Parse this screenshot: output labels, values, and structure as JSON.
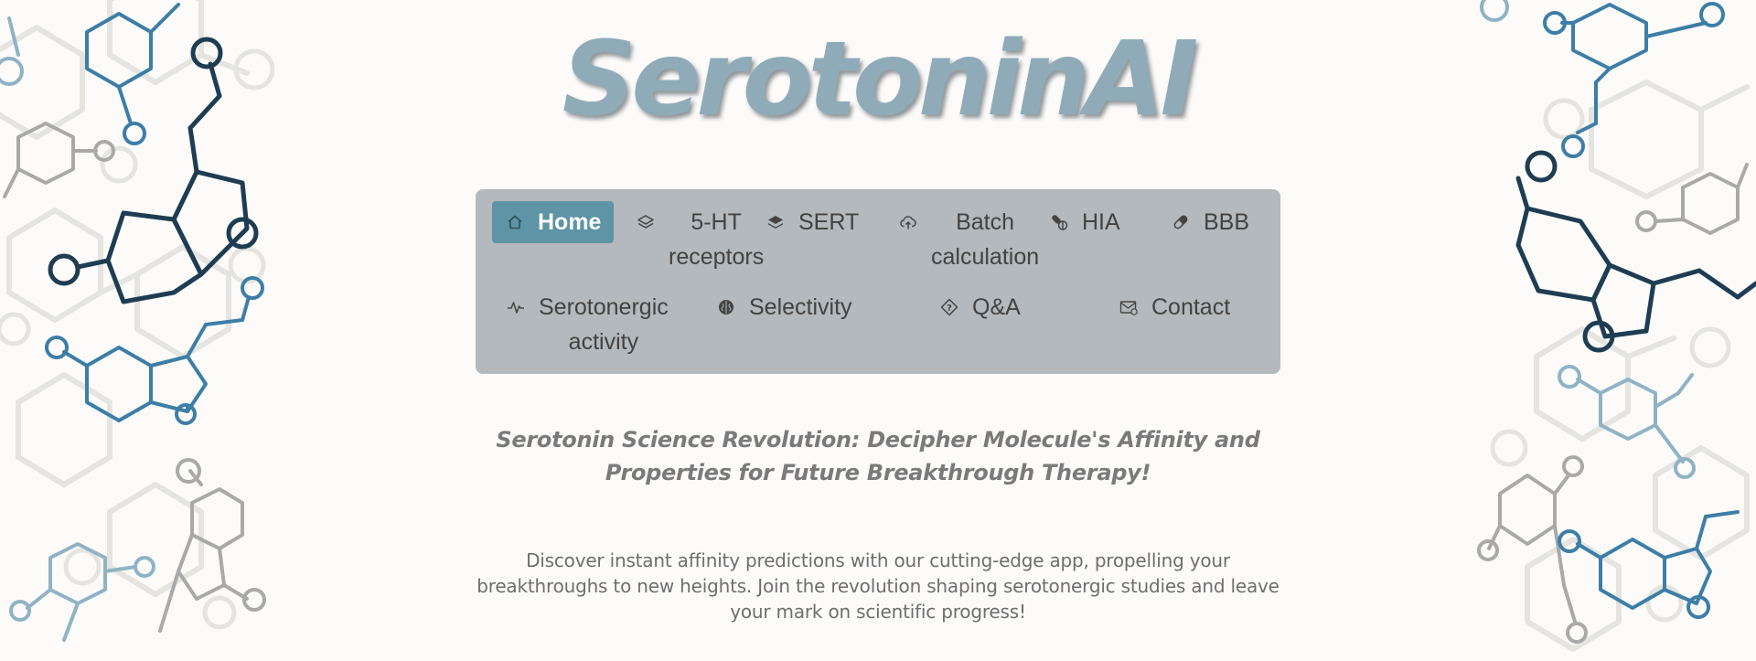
{
  "app": {
    "title": "SerotoninAI"
  },
  "nav": {
    "items": [
      {
        "label": "Home",
        "icon": "home-icon",
        "active": true
      },
      {
        "label": "5-HT\nreceptors",
        "icon": "layers-icon"
      },
      {
        "label": "SERT",
        "icon": "stack-icon"
      },
      {
        "label": "Batch\ncalculation",
        "icon": "cloud-upload-icon"
      },
      {
        "label": "HIA",
        "icon": "capsule-pills-icon"
      },
      {
        "label": "BBB",
        "icon": "pill-icon"
      },
      {
        "label": "Serotonergic\nactivity",
        "icon": "activity-icon"
      },
      {
        "label": "Selectivity",
        "icon": "brain-icon"
      },
      {
        "label": "Q&A",
        "icon": "question-diamond-icon"
      },
      {
        "label": "Contact",
        "icon": "mail-icon"
      }
    ]
  },
  "hero": {
    "tagline": "Serotonin Science Revolution: Decipher Molecule's Affinity and Properties for Future Breakthrough Therapy!",
    "intro": "Discover instant affinity predictions with our cutting-edge app, propelling your breakthroughs to new heights. Join the revolution shaping serotonergic studies and leave your mark on scientific progress!"
  },
  "theme": {
    "accent": "#5e94a5",
    "nav_bg": "#b3b9bc",
    "title_color": "#8fabb8",
    "molecule_dark": "#1f3d52",
    "molecule_blue": "#3d7ea6",
    "molecule_gray": "#a9a9a9"
  }
}
